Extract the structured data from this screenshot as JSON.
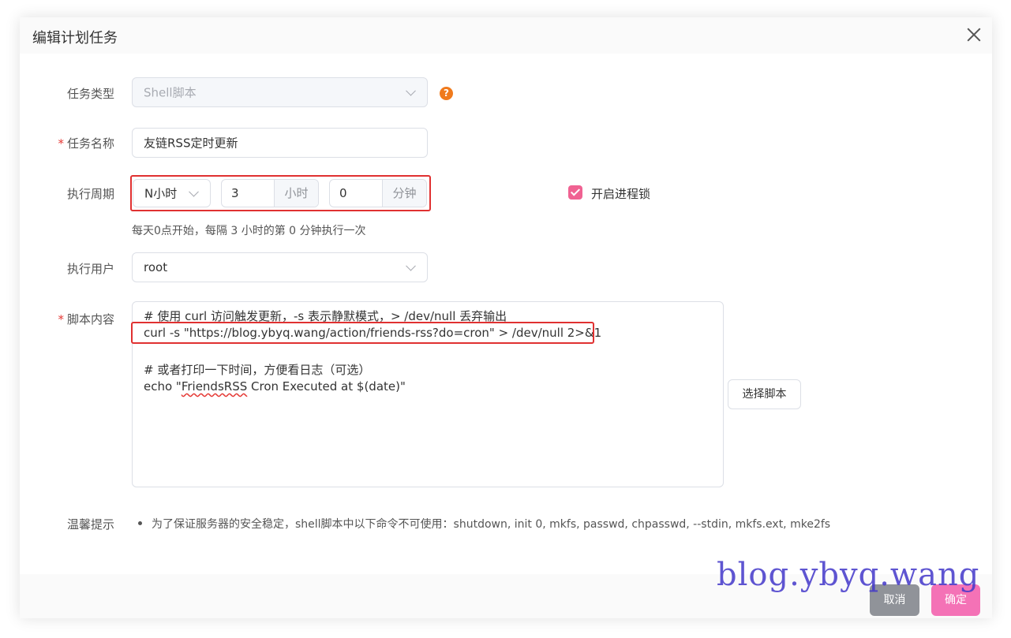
{
  "dialog": {
    "title": "编辑计划任务"
  },
  "form": {
    "task_type": {
      "label": "任务类型",
      "value": "Shell脚本",
      "help": "?"
    },
    "task_name": {
      "label": "任务名称",
      "required_mark": "*",
      "value": "友链RSS定时更新"
    },
    "schedule": {
      "label": "执行周期",
      "period_value": "N小时",
      "hours_value": "3",
      "hours_unit": "小时",
      "minutes_value": "0",
      "minutes_unit": "分钟",
      "lock_label": "开启进程锁",
      "lock_checked": true,
      "summary": "每天0点开始，每隔 3 小时的第 0 分钟执行一次"
    },
    "run_user": {
      "label": "执行用户",
      "value": "root"
    },
    "script": {
      "label": "脚本内容",
      "required_mark": "*",
      "line1": "# 使用 curl 访问触发更新，-s 表示静默模式，> /dev/null 丢弃输出",
      "line2": "curl -s \"https://blog.ybyq.wang/action/friends-rss?do=cron\" > /dev/null 2>&1",
      "line3": "# 或者打印一下时间，方便看日志（可选）",
      "line4_prefix": "echo \"",
      "line4_word": "FriendsRSS",
      "line4_suffix": " Cron Executed at $(date)\"",
      "choose_button": "选择脚本"
    },
    "tips": {
      "label": "温馨提示",
      "text": "为了保证服务器的安全稳定，shell脚本中以下命令不可使用：shutdown, init 0, mkfs, passwd, chpasswd, --stdin, mkfs.ext, mke2fs"
    }
  },
  "footer": {
    "cancel_label": "取消",
    "confirm_label": "确定"
  },
  "watermark": "blog.ybyq.wang",
  "colors": {
    "accent_pink": "#f472b6",
    "highlight_red": "#e03131",
    "help_orange": "#f07a1c"
  }
}
